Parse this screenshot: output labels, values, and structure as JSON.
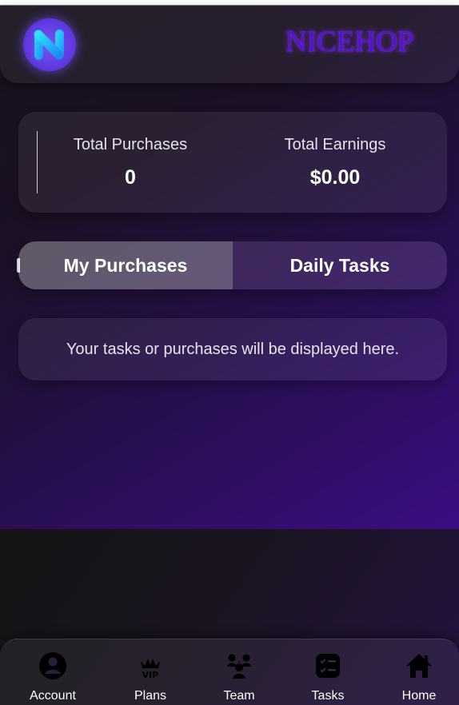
{
  "brand": {
    "name": "NICEHOP",
    "logo_icon": "n-letter-logo-icon",
    "accent_color": "#5312d6"
  },
  "stats": {
    "purchases_label": "Total Purchases",
    "purchases_value": "0",
    "earnings_label": "Total Earnings",
    "earnings_value": "$0.00"
  },
  "tabs": [
    {
      "label": "My Purchases",
      "active": true
    },
    {
      "label": "Daily Tasks",
      "active": false
    }
  ],
  "content": {
    "empty_message": "Your tasks or purchases will be displayed here."
  },
  "nav": [
    {
      "label": "Account",
      "icon": "user-circle-icon"
    },
    {
      "label": "Plans",
      "icon": "vip-crown-icon"
    },
    {
      "label": "Team",
      "icon": "team-users-icon"
    },
    {
      "label": "Tasks",
      "icon": "task-list-icon"
    },
    {
      "label": "Home",
      "icon": "home-icon"
    }
  ]
}
